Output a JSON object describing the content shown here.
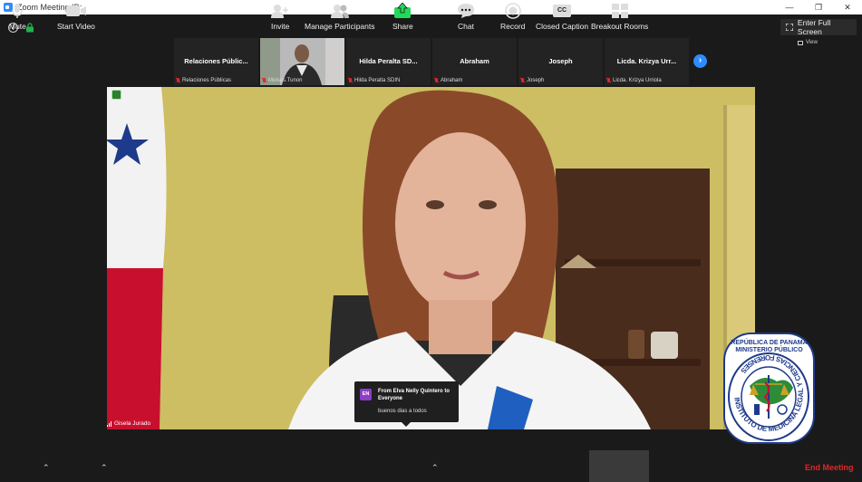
{
  "window": {
    "title": "Zoom Meeting ID:"
  },
  "header": {
    "fullscreen_label": "Enter Full Screen",
    "view_label": "View"
  },
  "thumbnails": [
    {
      "display": "Relaciones Públic...",
      "label": "Relaciones Públicas",
      "video": false
    },
    {
      "display": "",
      "label": "Moises.Tunon",
      "video": true
    },
    {
      "display": "Hilda Peralta SD...",
      "label": "Hilda Peralta SDIN",
      "video": false
    },
    {
      "display": "Abraham",
      "label": "Abraham",
      "video": false
    },
    {
      "display": "Joseph",
      "label": "Joseph",
      "video": false
    },
    {
      "display": "Licda. Krizya Urr...",
      "label": "Licda. Krizya Urriola",
      "video": false
    }
  ],
  "main": {
    "speaker_name": "Gisela Jurado"
  },
  "chat_popup": {
    "avatar_initials": "EN",
    "from": "From Elva Nelly Quintero to Everyone",
    "message": "buenos dias a todos"
  },
  "seal": {
    "top_line1": "REPÚBLICA DE PANAMÁ",
    "top_line2": "MINISTERIO PÚBLICO",
    "ring_text": "INSTITUTO DE MEDICINA LEGAL Y CIENCIAS FORENSES"
  },
  "toolbar": {
    "mute": "Mute",
    "start_video": "Start Video",
    "invite": "Invite",
    "manage_participants": "Manage Participants",
    "share": "Share",
    "chat": "Chat",
    "record": "Record",
    "closed_caption": "Closed Caption",
    "cc_glyph": "CC",
    "breakout_rooms": "Breakout Rooms",
    "end_meeting": "End Meeting"
  },
  "colors": {
    "accent": "#2d8cff",
    "share_green": "#23d959",
    "end_red": "#e02828",
    "avatar_purple": "#8e3ec9"
  }
}
